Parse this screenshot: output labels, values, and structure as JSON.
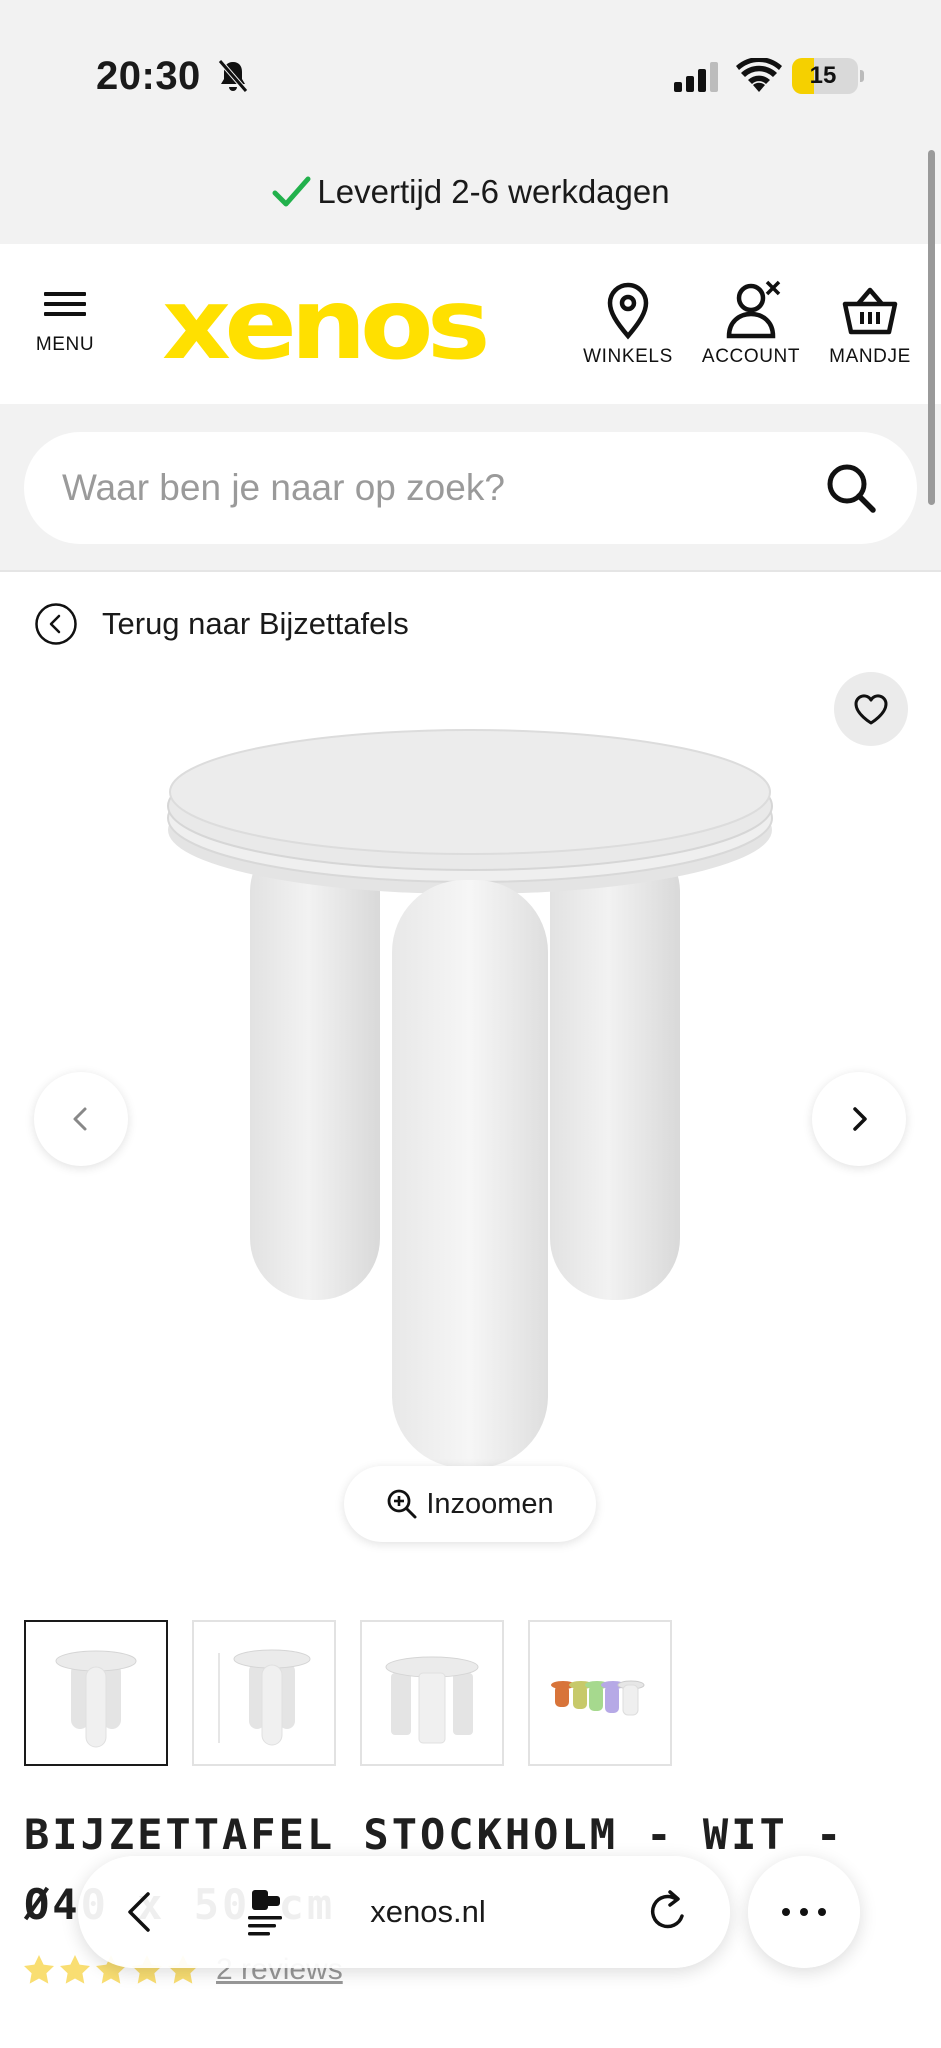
{
  "status_bar": {
    "time": "20:30",
    "battery": "15",
    "icons": [
      "bell-slash-icon",
      "cellular-signal-icon",
      "wifi-icon",
      "battery-icon"
    ]
  },
  "banner": {
    "delivery_text": "Levertijd 2-6 werkdagen",
    "check_color": "#22b14c"
  },
  "header": {
    "menu_label": "MENU",
    "logo_text": "xenos",
    "logo_color": "#ffe000",
    "winkels_label": "WINKELS",
    "account_label": "ACCOUNT",
    "mandje_label": "MANDJE"
  },
  "search": {
    "placeholder": "Waar ben je naar op zoek?",
    "value": ""
  },
  "breadcrumb": {
    "back_text": "Terug naar Bijzettafels"
  },
  "gallery": {
    "zoom_label": "Inzoomen",
    "thumbnail_count": 4,
    "active_thumbnail": 1
  },
  "product": {
    "title": "BIJZETTAFEL STOCKHOLM - WIT - Ø40 x 50 cm",
    "rating": 5,
    "reviews_label": "2 reviews",
    "star_color": "#f5c400"
  },
  "browser": {
    "url": "xenos.nl"
  }
}
